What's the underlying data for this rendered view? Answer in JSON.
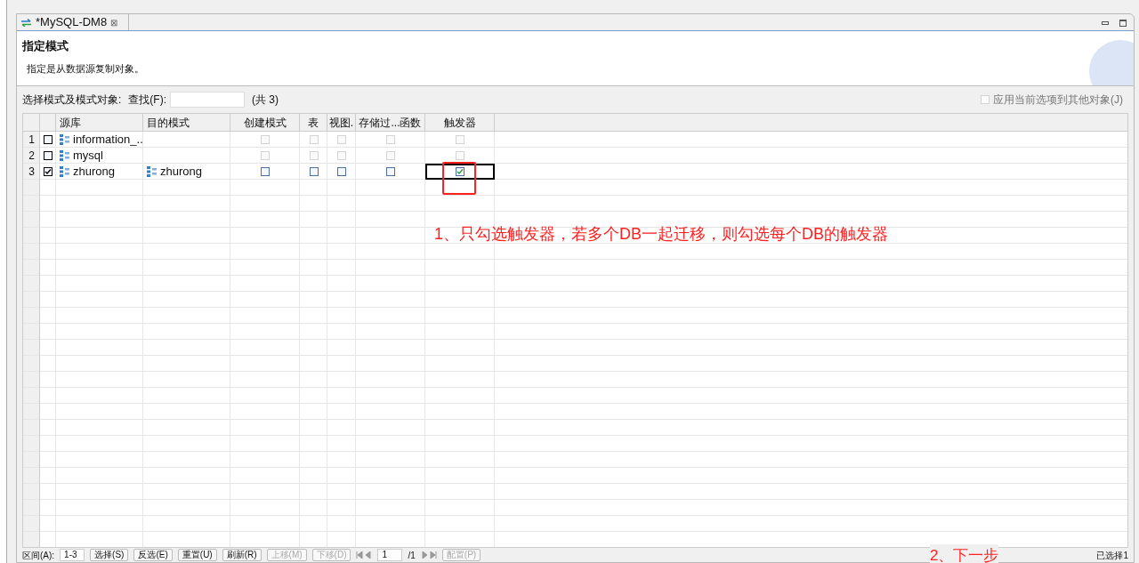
{
  "tab": {
    "title": "*MySQL-DM8",
    "close": "⊠"
  },
  "header": {
    "title": "指定模式",
    "description": "指定是从数据源复制对象。"
  },
  "toolbar": {
    "label": "选择模式及模式对象:",
    "search_label": "查找(F):",
    "count": "(共 3)",
    "apply_option": {
      "label": "应用当前选项到其他对象(J)",
      "checked": false,
      "disabled": true
    }
  },
  "table": {
    "columns": [
      "源库",
      "目的模式",
      "创建模式",
      "表",
      "视图.",
      "存储过...函数",
      "触发器"
    ],
    "rows": [
      {
        "number": "1",
        "checked": false,
        "source": "information_..",
        "options": [
          {
            "checked": false,
            "disabled": true,
            "selected": false
          },
          {
            "checked": false,
            "disabled": true,
            "selected": false
          },
          {
            "checked": false,
            "disabled": true,
            "selected": false
          },
          {
            "checked": false,
            "disabled": true,
            "selected": false
          },
          {
            "checked": false,
            "disabled": true,
            "selected": false
          }
        ]
      },
      {
        "number": "2",
        "checked": false,
        "source": "mysql",
        "options": [
          {
            "checked": false,
            "disabled": true,
            "selected": false
          },
          {
            "checked": false,
            "disabled": true,
            "selected": false
          },
          {
            "checked": false,
            "disabled": true,
            "selected": false
          },
          {
            "checked": false,
            "disabled": true,
            "selected": false
          },
          {
            "checked": false,
            "disabled": true,
            "selected": false
          }
        ]
      },
      {
        "number": "3",
        "checked": true,
        "source": "zhurong",
        "target": "zhurong",
        "options": [
          {
            "checked": false,
            "disabled": false,
            "selected": false
          },
          {
            "checked": false,
            "disabled": false,
            "selected": false
          },
          {
            "checked": false,
            "disabled": false,
            "selected": false
          },
          {
            "checked": false,
            "disabled": false,
            "selected": false
          },
          {
            "checked": true,
            "disabled": false,
            "selected": true
          }
        ]
      }
    ]
  },
  "bottom_bar": [
    {
      "kind": "label",
      "text": "区间(A):"
    },
    {
      "kind": "field",
      "text": "1-3"
    },
    {
      "kind": "button",
      "text": "选择(S)",
      "disabled": false
    },
    {
      "kind": "button",
      "text": "反选(E)",
      "disabled": false
    },
    {
      "kind": "button",
      "text": "重置(U)",
      "disabled": false
    },
    {
      "kind": "button",
      "text": "刷新(R)",
      "disabled": false
    },
    {
      "kind": "button",
      "text": "上移(M)",
      "disabled": true
    },
    {
      "kind": "button",
      "text": "下移(D)",
      "disabled": true
    },
    {
      "kind": "nav_back"
    },
    {
      "kind": "field",
      "text": "1"
    },
    {
      "kind": "label",
      "text": "/1"
    },
    {
      "kind": "nav_forward"
    },
    {
      "kind": "button",
      "text": "配置(P)",
      "disabled": true
    }
  ],
  "status": "已选择1",
  "annotations": [
    {
      "text": "1、只勾选触发器，若多个DB一起迁移，则勾选每个DB的触发器"
    },
    {
      "text": "2、下一步"
    }
  ]
}
